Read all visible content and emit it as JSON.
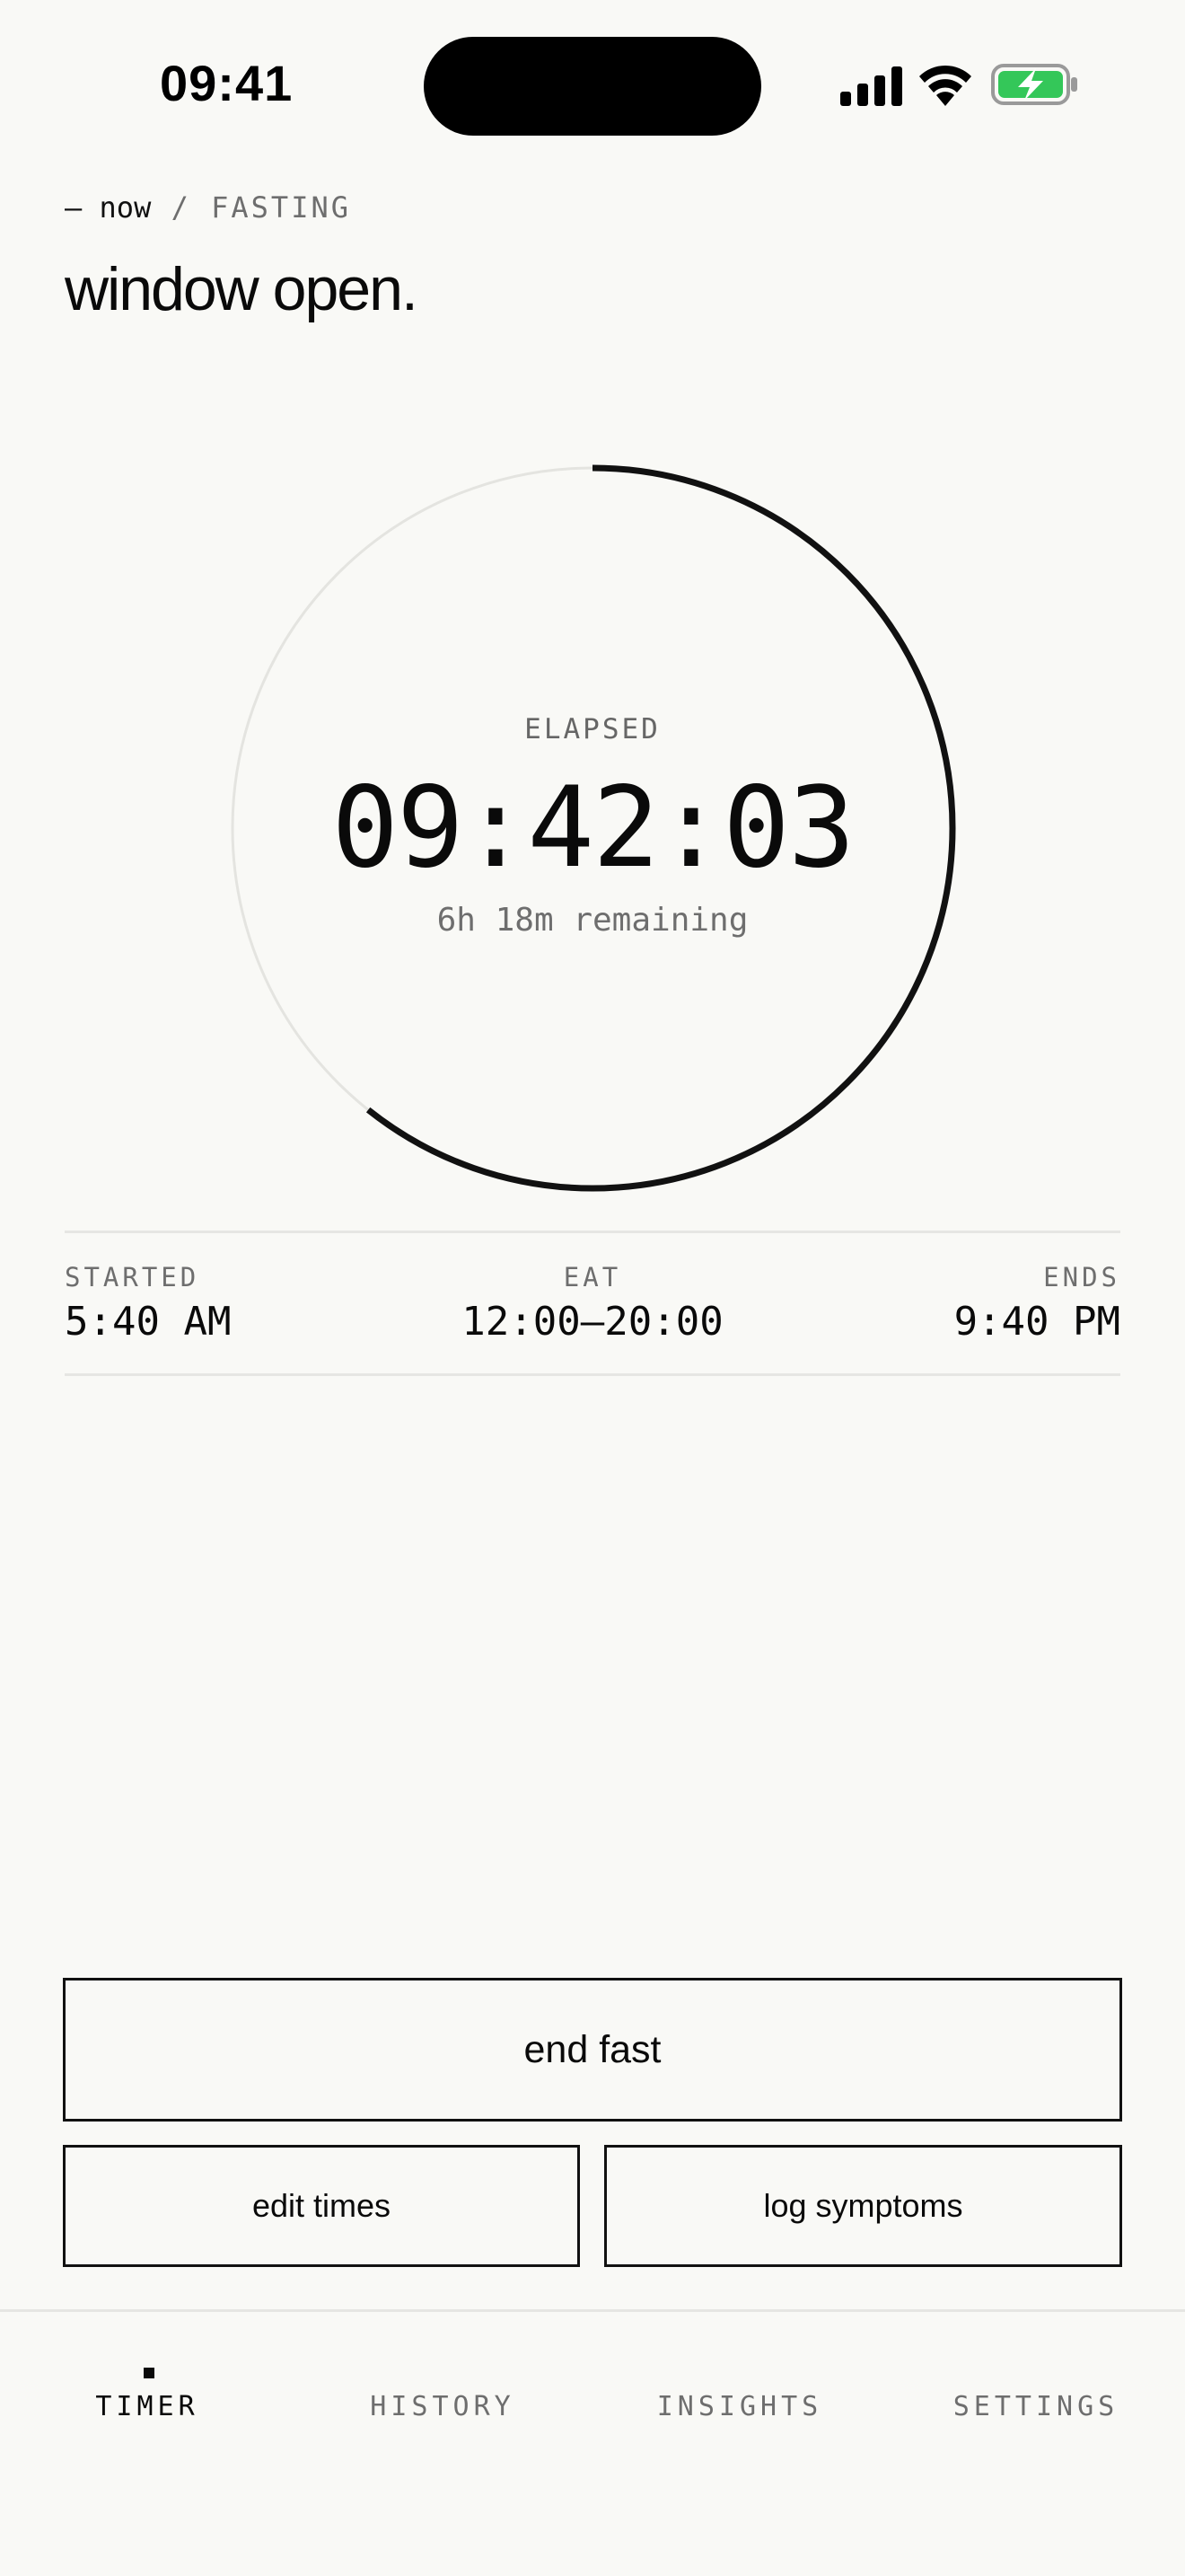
{
  "status_bar": {
    "time": "09:41",
    "icons": [
      "signal-icon",
      "wifi-icon",
      "battery-charging-icon"
    ],
    "battery_color": "#34c759"
  },
  "header": {
    "crumb_now": "— now",
    "crumb_sep": " / ",
    "crumb_section": "FASTING",
    "title": "window open."
  },
  "timer": {
    "label": "ELAPSED",
    "elapsed": "09:42:03",
    "remaining": "6h 18m remaining",
    "progress_fraction": 0.607,
    "accent_color": "#111111",
    "track_color": "#e4e4e0"
  },
  "stats": [
    {
      "label": "STARTED",
      "value": "5:40 AM"
    },
    {
      "label": "EAT",
      "value": "12:00–20:00"
    },
    {
      "label": "ENDS",
      "value": "9:40 PM"
    }
  ],
  "actions": {
    "primary": "end fast",
    "edit": "edit times",
    "log": "log symptoms"
  },
  "tabs": [
    {
      "label": "TIMER",
      "active": true
    },
    {
      "label": "HISTORY",
      "active": false
    },
    {
      "label": "INSIGHTS",
      "active": false
    },
    {
      "label": "SETTINGS",
      "active": false
    }
  ]
}
